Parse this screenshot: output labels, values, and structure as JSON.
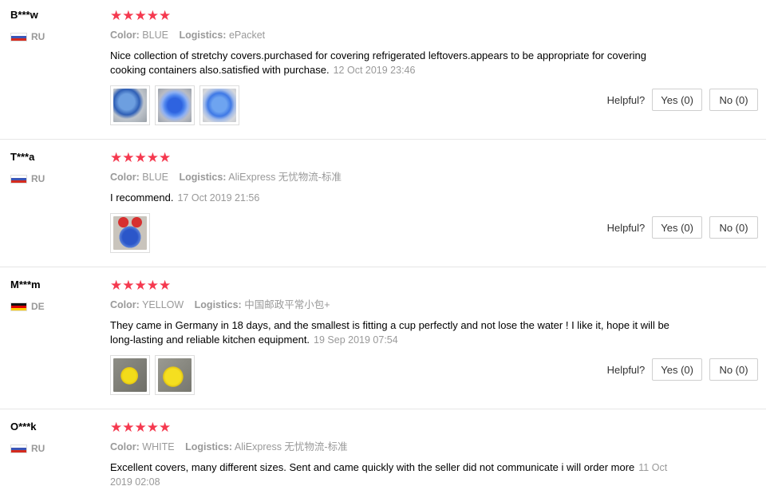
{
  "reviews": [
    {
      "user": "B***w",
      "country": "RU",
      "stars": "★★★★★",
      "color_label": "Color:",
      "color": "BLUE",
      "logistics_label": "Logistics:",
      "logistics": "ePacket",
      "text": "Nice collection of stretchy covers.purchased for covering refrigerated leftovers.appears to be appropriate for covering cooking containers also.satisfied with purchase.",
      "date": "12 Oct 2019 23:46",
      "photos": [
        "blue-covers-photo",
        "blue-covers-photo",
        "blue-lid-photo"
      ],
      "helpful_label": "Helpful?",
      "yes_label": "Yes (0)",
      "no_label": "No (0)"
    },
    {
      "user": "T***a",
      "country": "RU",
      "stars": "★★★★★",
      "color_label": "Color:",
      "color": "BLUE",
      "logistics_label": "Logistics:",
      "logistics": "AliExpress 无忧物流-标准",
      "text": "I recommend.",
      "date": "17 Oct 2019 21:56",
      "photos": [
        "blue-red-covers-photo"
      ],
      "helpful_label": "Helpful?",
      "yes_label": "Yes (0)",
      "no_label": "No (0)"
    },
    {
      "user": "M***m",
      "country": "DE",
      "stars": "★★★★★",
      "color_label": "Color:",
      "color": "YELLOW",
      "logistics_label": "Logistics:",
      "logistics": "中国邮政平常小包+",
      "text": "They came in Germany in 18 days, and the smallest is fitting a cup perfectly and not lose the water ! I like it, hope it will be long-lasting and reliable kitchen equipment.",
      "date": "19 Sep 2019 07:54",
      "photos": [
        "yellow-cover-photo",
        "yellow-cover-photo"
      ],
      "helpful_label": "Helpful?",
      "yes_label": "Yes (0)",
      "no_label": "No (0)"
    },
    {
      "user": "O***k",
      "country": "RU",
      "stars": "★★★★★",
      "color_label": "Color:",
      "color": "WHITE",
      "logistics_label": "Logistics:",
      "logistics": "AliExpress 无忧物流-标准",
      "text": "Excellent covers, many different sizes. Sent and came quickly with the seller did not communicate i will order more",
      "date": "11 Oct 2019 02:08"
    }
  ],
  "colors": {
    "star": "#f5394f",
    "muted": "#999999"
  }
}
